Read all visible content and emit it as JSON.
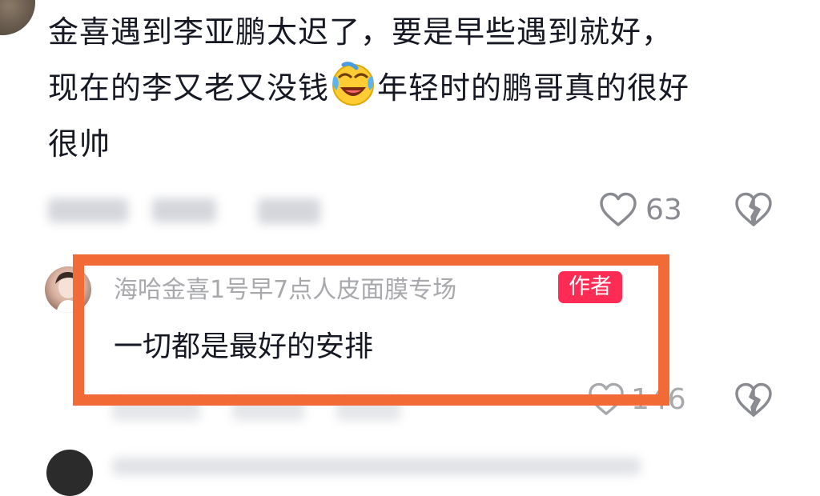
{
  "comment": {
    "line1": "金喜遇到李亚鹏太迟了，要是早些遇到就好，",
    "line2_before_emoji": "现在的李又老又没钱",
    "emoji_name": "laughing-crying-emoji",
    "line2_after_emoji": "年轻时的鹏哥真的很好",
    "line3": "很帅",
    "like_count": "63"
  },
  "reply": {
    "author_name": "海哈金喜1号早7点人皮面膜专场",
    "author_badge": "作者",
    "text": "一切都是最好的安排",
    "like_count": "146"
  },
  "colors": {
    "highlight_border": "#f26b37",
    "badge_bg": "#fe2c55",
    "muted_text": "#a8a9ad",
    "icon_gray": "#8a8b91"
  }
}
